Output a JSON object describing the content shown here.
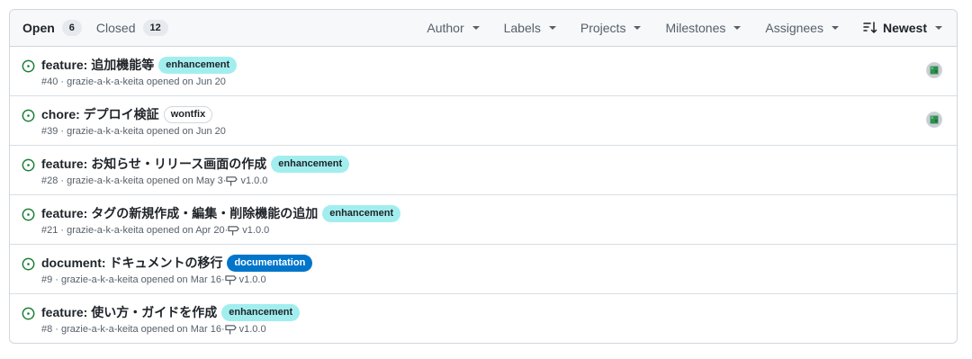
{
  "header": {
    "open_label": "Open",
    "open_count": "6",
    "closed_label": "Closed",
    "closed_count": "12",
    "filters": [
      "Author",
      "Labels",
      "Projects",
      "Milestones",
      "Assignees"
    ],
    "sort_label": "Newest"
  },
  "issues": [
    {
      "title": "feature: 追加機能等",
      "label": "enhancement",
      "meta": "#40 · grazie-a-k-a-keita opened on Jun 20",
      "milestone": "",
      "has_avatar": true
    },
    {
      "title": "chore: デプロイ検証",
      "label": "wontfix",
      "meta": "#39 · grazie-a-k-a-keita opened on Jun 20",
      "milestone": "",
      "has_avatar": true
    },
    {
      "title": "feature: お知らせ・リリース画面の作成",
      "label": "enhancement",
      "meta": "#28 · grazie-a-k-a-keita opened on May 3·",
      "milestone": "v1.0.0",
      "has_avatar": false
    },
    {
      "title": "feature: タグの新規作成・編集・削除機能の追加",
      "label": "enhancement",
      "meta": "#21 · grazie-a-k-a-keita opened on Apr 20·",
      "milestone": "v1.0.0",
      "has_avatar": false
    },
    {
      "title": "document: ドキュメントの移行",
      "label": "documentation",
      "meta": "#9 · grazie-a-k-a-keita opened on Mar 16·",
      "milestone": "v1.0.0",
      "has_avatar": false
    },
    {
      "title": "feature: 使い方・ガイドを作成",
      "label": "enhancement",
      "meta": "#8 · grazie-a-k-a-keita opened on Mar 16·",
      "milestone": "v1.0.0",
      "has_avatar": false
    }
  ],
  "colors": {
    "open_icon": "#1a7f37",
    "enhancement": "#a2eeef",
    "documentation": "#0075ca",
    "border": "#d0d7de"
  },
  "icons": {
    "issue_state": "issue-opened-icon",
    "milestone": "milestone-icon",
    "sort": "sort-desc-icon",
    "caret": "triangle-down-icon"
  }
}
